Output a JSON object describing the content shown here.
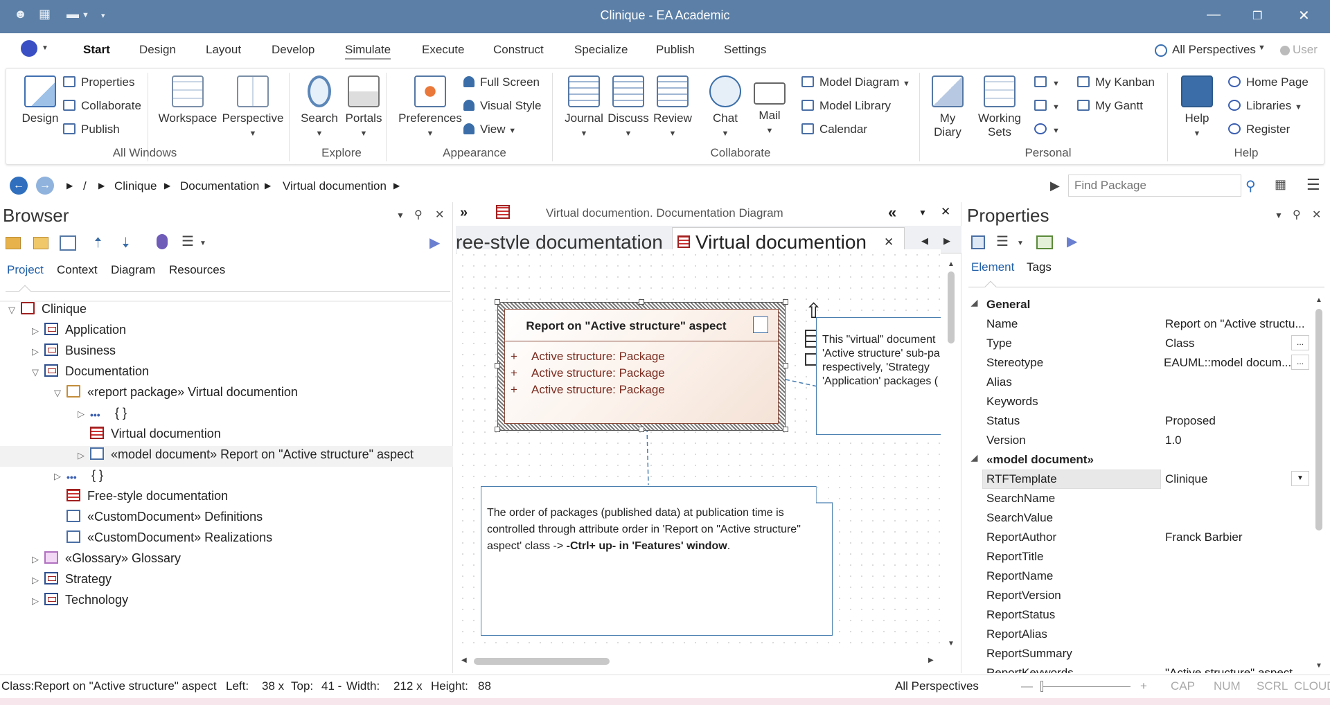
{
  "window": {
    "title": "Clinique - EA Academic"
  },
  "menu": {
    "tabs": [
      "Start",
      "Design",
      "Layout",
      "Develop",
      "Simulate",
      "Execute",
      "Construct",
      "Specialize",
      "Publish",
      "Settings"
    ],
    "perspectives": "All Perspectives",
    "user": "User"
  },
  "ribbon": {
    "all_windows": {
      "label": "All Windows",
      "design": "Design",
      "properties": "Properties",
      "collaborate": "Collaborate",
      "publish": "Publish",
      "workspace": "Workspace",
      "perspective": "Perspective"
    },
    "explore": {
      "label": "Explore",
      "search": "Search",
      "portals": "Portals"
    },
    "appearance": {
      "label": "Appearance",
      "preferences": "Preferences",
      "full_screen": "Full Screen",
      "visual_style": "Visual Style",
      "view": "View"
    },
    "collaborate": {
      "label": "Collaborate",
      "journal": "Journal",
      "discuss": "Discuss",
      "review": "Review",
      "chat": "Chat",
      "mail": "Mail",
      "model_diagram": "Model Diagram",
      "model_library": "Model Library",
      "calendar": "Calendar"
    },
    "personal": {
      "label": "Personal",
      "my_diary_1": "My",
      "my_diary_2": "Diary",
      "working_sets_1": "Working",
      "working_sets_2": "Sets",
      "my_kanban": "My Kanban",
      "my_gantt": "My Gantt"
    },
    "help": {
      "label": "Help",
      "help": "Help",
      "home_page": "Home Page",
      "libraries": "Libraries",
      "register": "Register"
    }
  },
  "address": {
    "root": "/",
    "crumbs": [
      "Clinique",
      "Documentation",
      "Virtual documention"
    ],
    "find_placeholder": "Find Package"
  },
  "browser": {
    "title": "Browser",
    "tabs": [
      "Project",
      "Context",
      "Diagram",
      "Resources"
    ],
    "tree": [
      {
        "label": "Clinique"
      },
      {
        "label": "Application"
      },
      {
        "label": "Business"
      },
      {
        "label": "Documentation"
      },
      {
        "label": "«report package» Virtual documention"
      },
      {
        "label": "{ }"
      },
      {
        "label": "Virtual documention"
      },
      {
        "label": "«model document» Report on \"Active structure\" aspect"
      },
      {
        "label": "{ }"
      },
      {
        "label": "Free-style documentation"
      },
      {
        "label": "«CustomDocument» Definitions"
      },
      {
        "label": "«CustomDocument» Realizations"
      },
      {
        "label": "«Glossary» Glossary"
      },
      {
        "label": "Strategy"
      },
      {
        "label": "Technology"
      }
    ]
  },
  "diagram": {
    "header": "Virtual documention.  Documentation Diagram",
    "tab_prev": "ree-style documentation",
    "tab_active": "Virtual documention",
    "class_title": "Report on \"Active structure\" aspect",
    "attrs": [
      "Active structure: Package",
      "Active structure: Package",
      "Active structure: Package"
    ],
    "note_text_1": "The order of packages (published data) at publication time is controlled through attribute order in 'Report on \"Active structure\" aspect' class -> ",
    "note_text_bold": "-Ctrl+ up- in 'Features' window",
    "note_text_end": ".",
    "note2_lines": [
      "This \"virtual\" document",
      "'Active structure' sub-pa",
      "respectively,  'Strategy",
      "'Application' packages ("
    ]
  },
  "properties": {
    "title": "Properties",
    "tabs": [
      "Element",
      "Tags"
    ],
    "general_header": "General",
    "general": [
      {
        "name": "Name",
        "value": "Report on \"Active structu..."
      },
      {
        "name": "Type",
        "value": "Class"
      },
      {
        "name": "Stereotype",
        "value": "EAUML::model docum..."
      },
      {
        "name": "Alias",
        "value": ""
      },
      {
        "name": "Keywords",
        "value": ""
      },
      {
        "name": "Status",
        "value": "Proposed"
      },
      {
        "name": "Version",
        "value": "1.0"
      }
    ],
    "md_header": "«model document»",
    "model_document": [
      {
        "name": "RTFTemplate",
        "value": "Clinique"
      },
      {
        "name": "SearchName",
        "value": ""
      },
      {
        "name": "SearchValue",
        "value": ""
      },
      {
        "name": "ReportAuthor",
        "value": "Franck Barbier"
      },
      {
        "name": "ReportTitle",
        "value": ""
      },
      {
        "name": "ReportName",
        "value": ""
      },
      {
        "name": "ReportVersion",
        "value": ""
      },
      {
        "name": "ReportStatus",
        "value": ""
      },
      {
        "name": "ReportAlias",
        "value": ""
      },
      {
        "name": "ReportSummary",
        "value": ""
      },
      {
        "name": "ReportKeywords",
        "value": "\"Active structure\" aspect"
      }
    ]
  },
  "status": {
    "element": "Class:Report on \"Active structure\" aspect",
    "left_label": "Left:",
    "left_val": "38 x",
    "top_label": "Top:",
    "top_val": "41 -",
    "width_label": "Width:",
    "width_val": "212 x",
    "height_label": "Height:",
    "height_val": "88",
    "perspectives": "All Perspectives",
    "indicators": [
      "CAP",
      "NUM",
      "SCRL",
      "CLOUD"
    ]
  }
}
